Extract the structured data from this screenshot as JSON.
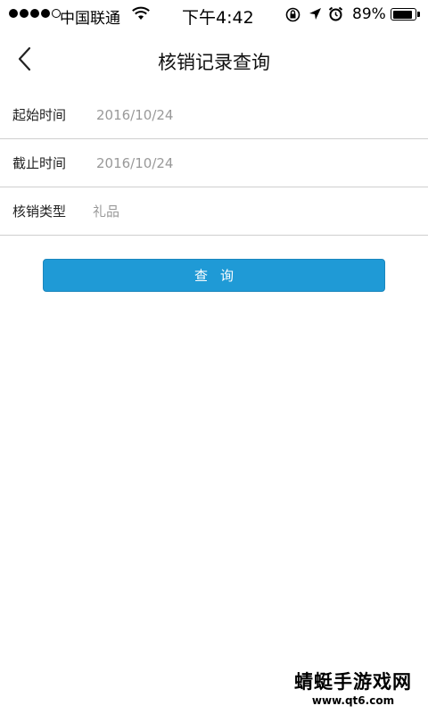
{
  "status_bar": {
    "carrier": "中国联通",
    "time": "下午4:42",
    "battery_percent": "89%",
    "battery_level": 0.89,
    "signal_bars_filled": 4,
    "signal_bars_total": 5
  },
  "nav": {
    "title": "核销记录查询",
    "back_icon": "chevron-left-icon"
  },
  "form": {
    "start_time": {
      "label": "起始时间",
      "value": "2016/10/24"
    },
    "end_time": {
      "label": "截止时间",
      "value": "2016/10/24"
    },
    "type": {
      "label": "核销类型",
      "value": "礼品"
    }
  },
  "query_button": {
    "label": "查询",
    "color": "#1f9ad6"
  },
  "watermark": {
    "text": "蜻蜓手游戏网",
    "url": "www.qt6.com"
  }
}
